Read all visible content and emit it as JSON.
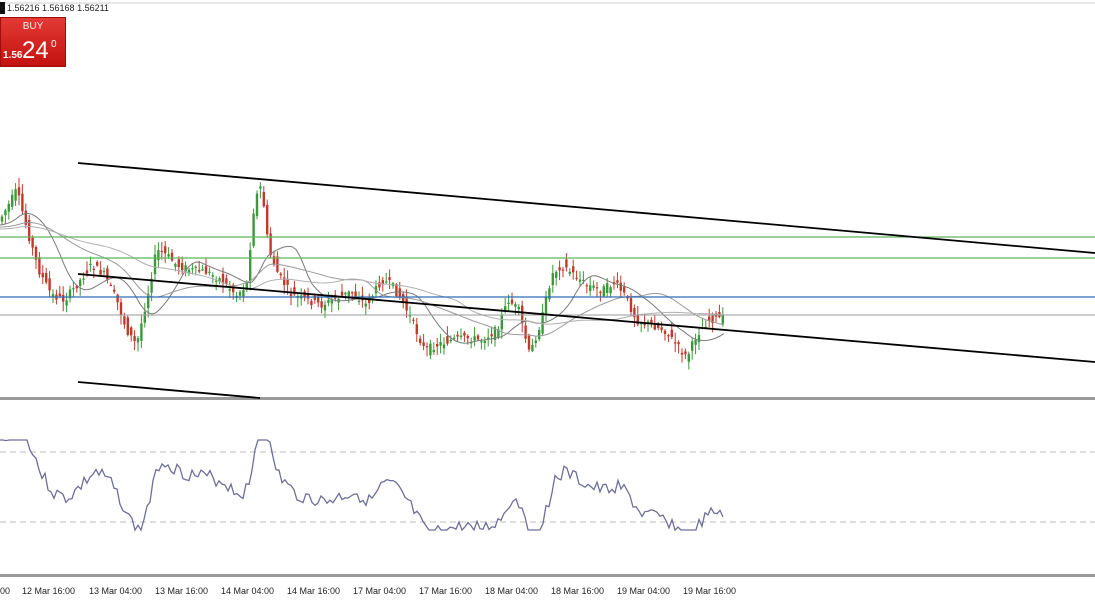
{
  "quote": {
    "text": "1.56216 1.56168 1.56211"
  },
  "trade_panel": {
    "buy_label": "BUY",
    "price_small": "1.56",
    "price_big": "24",
    "price_sup": "0"
  },
  "time_axis": {
    "labels": [
      "00",
      "12 Mar 16:00",
      "13 Mar 04:00",
      "13 Mar 16:00",
      "14 Mar 04:00",
      "14 Mar 16:00",
      "17 Mar 04:00",
      "17 Mar 16:00",
      "18 Mar 04:00",
      "18 Mar 16:00",
      "19 Mar 04:00",
      "19 Mar 16:00"
    ]
  },
  "colors": {
    "background": "#ffffff",
    "bull_candle": "#3a9a3a",
    "bear_candle": "#c0392b",
    "trend_lines": "#000000",
    "green_levels": "#5cb85c",
    "blue_level": "#2f6db5",
    "ma_lines": "#7a7a7a",
    "oscillator": "#6e6e9a",
    "buy_button": "#d42420"
  }
}
